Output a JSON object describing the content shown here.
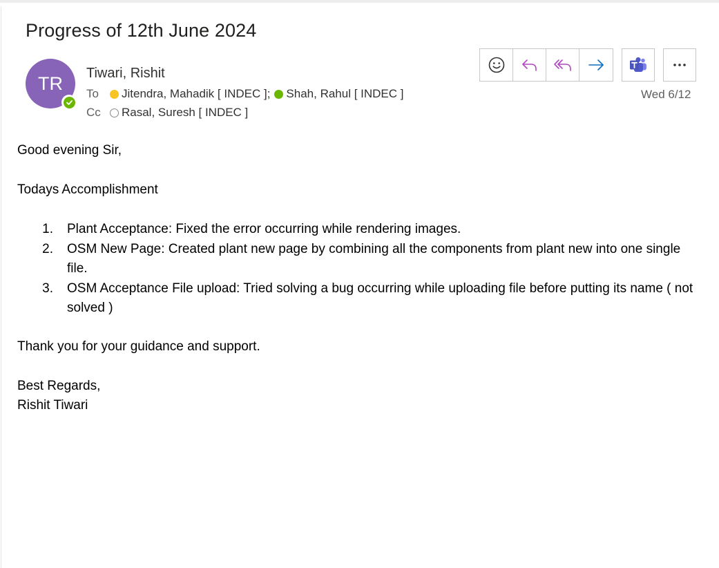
{
  "email": {
    "subject": "Progress of 12th June 2024",
    "sender": {
      "initials": "TR",
      "name": "Tiwari, Rishit",
      "avatar_color": "#8764b8",
      "presence": "available"
    },
    "to_label": "To",
    "to": [
      {
        "name": "Jitendra, Mahadik [ INDEC ];",
        "presence": "away"
      },
      {
        "name": "Shah, Rahul [ INDEC ]",
        "presence": "available"
      }
    ],
    "cc_label": "Cc",
    "cc": [
      {
        "name": "Rasal, Suresh [ INDEC ]",
        "presence": "offline"
      }
    ],
    "date": "Wed 6/12"
  },
  "toolbar": {
    "icons": [
      "emoji-icon",
      "reply-icon",
      "reply-all-icon",
      "forward-icon",
      "teams-icon",
      "more-icon"
    ]
  },
  "body": {
    "greeting": "Good evening Sir,",
    "heading": "Todays Accomplishment",
    "items": [
      {
        "num": "1.",
        "text": "Plant Acceptance: Fixed the error occurring while rendering images."
      },
      {
        "num": "2.",
        "text": "OSM New Page: Created plant new page by combining all the components from plant new into one single file."
      },
      {
        "num": "3.",
        "text": "OSM Acceptance File upload: Tried solving a bug occurring while uploading file before putting its name ( not solved )"
      }
    ],
    "thanks": "Thank you for your guidance and support.",
    "closing": "Best Regards,",
    "signature": "Rishit Tiwari"
  },
  "colors": {
    "away": "#f8c421",
    "available": "#6bb700",
    "reply_accent": "#b146c2",
    "forward_accent": "#0f6cbd",
    "teams": "#5059c9"
  }
}
